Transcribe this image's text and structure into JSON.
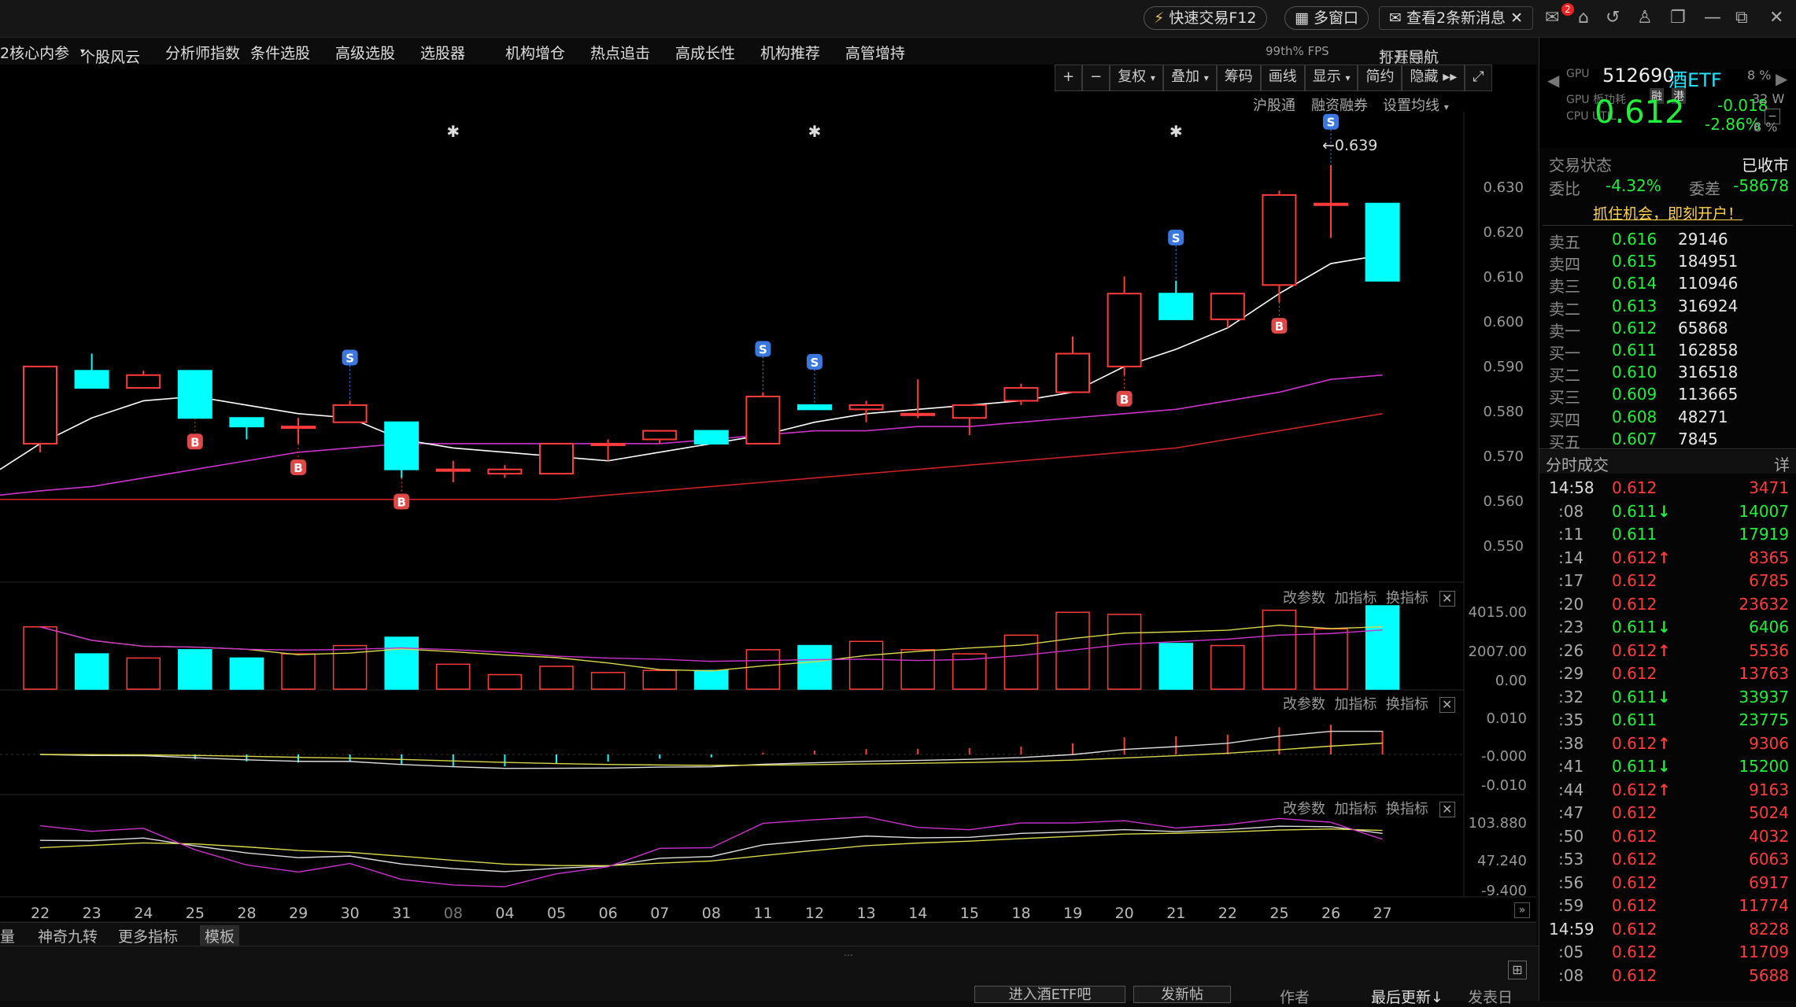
{
  "titlebar": {
    "quick_trade": "快速交易F12",
    "multi_window": "多窗口",
    "messages": "查看2条新消息",
    "mail_badge": "2",
    "fps": "99th% FPS",
    "open_nav": "打开导航",
    "no_return": "不返回"
  },
  "menu": [
    "2核心内参",
    "个股风云",
    "分析师指数",
    "条件选股",
    "高级选股",
    "选股器",
    "机构增仓",
    "热点追击",
    "高成长性",
    "机构推荐",
    "高管增持"
  ],
  "toolbar": [
    "+",
    "−",
    "复权",
    "叠加",
    "筹码",
    "画线",
    "显示",
    "简约",
    "隐藏"
  ],
  "subtoolbar": [
    "沪股通",
    "融资融券",
    "设置均线"
  ],
  "price_axis": [
    "0.630",
    "0.620",
    "0.610",
    "0.600",
    "0.590",
    "0.580",
    "0.570",
    "0.560",
    "0.550"
  ],
  "vol_axis": [
    "4015.00",
    "2007.00",
    "0.00"
  ],
  "macd_axis": [
    "0.010",
    "-0.000",
    "-0.010"
  ],
  "kdj_axis": [
    "103.880",
    "47.240",
    "-9.400"
  ],
  "panel_buttons": {
    "param": "改参数",
    "add": "加指标",
    "swap": "换指标"
  },
  "high_label": "←0.639",
  "dates": [
    "22",
    "23",
    "24",
    "25",
    "28",
    "29",
    "30",
    "31",
    "08",
    "04",
    "05",
    "06",
    "07",
    "08",
    "11",
    "12",
    "13",
    "14",
    "15",
    "18",
    "19",
    "20",
    "21",
    "22",
    "25",
    "26",
    "27"
  ],
  "bottom_tabs": [
    "量",
    "神奇九转",
    "更多指标",
    "模板"
  ],
  "footer": {
    "enter_bar": "进入酒ETF吧",
    "post": "发新帖",
    "author": "作者",
    "last_update": "最后更新↓",
    "post_date": "发表日"
  },
  "quote": {
    "code": "512690",
    "name": "酒ETF",
    "price": "0.612",
    "change": "-0.018",
    "pct": "-2.86%",
    "tag1": "融",
    "tag2": "港",
    "gpu_label": "GPU",
    "gpu_val": "8 %",
    "gpu_power": "GPU 板功耗",
    "power_val": "32 W",
    "cpu_util": "CPU UTIL",
    "cpu_val": "8 %"
  },
  "trade_status": {
    "label": "交易状态",
    "value": "已收市"
  },
  "wei": {
    "ratio_label": "委比",
    "ratio": "-4.32%",
    "diff_label": "委差",
    "diff": "-58678"
  },
  "promo": "抓住机会，即刻开户！",
  "asks": [
    {
      "label": "卖五",
      "price": "0.616",
      "vol": "29146"
    },
    {
      "label": "卖四",
      "price": "0.615",
      "vol": "184951"
    },
    {
      "label": "卖三",
      "price": "0.614",
      "vol": "110946"
    },
    {
      "label": "卖二",
      "price": "0.613",
      "vol": "316924"
    },
    {
      "label": "卖一",
      "price": "0.612",
      "vol": "65868"
    }
  ],
  "bids": [
    {
      "label": "买一",
      "price": "0.611",
      "vol": "162858"
    },
    {
      "label": "买二",
      "price": "0.610",
      "vol": "316518"
    },
    {
      "label": "买三",
      "price": "0.609",
      "vol": "113665"
    },
    {
      "label": "买四",
      "price": "0.608",
      "vol": "48271"
    },
    {
      "label": "买五",
      "price": "0.607",
      "vol": "7845"
    }
  ],
  "ticks_title": "分时成交",
  "ticks_detail": "详",
  "ticks": [
    {
      "t": "14:58",
      "p": "0.612",
      "a": "",
      "v": "3471",
      "c": "red"
    },
    {
      "t": ":08",
      "p": "0.611",
      "a": "↓",
      "v": "14007",
      "c": "green"
    },
    {
      "t": ":11",
      "p": "0.611",
      "a": "",
      "v": "17919",
      "c": "green"
    },
    {
      "t": ":14",
      "p": "0.612",
      "a": "↑",
      "v": "8365",
      "c": "red"
    },
    {
      "t": ":17",
      "p": "0.612",
      "a": "",
      "v": "6785",
      "c": "red"
    },
    {
      "t": ":20",
      "p": "0.612",
      "a": "",
      "v": "23632",
      "c": "red"
    },
    {
      "t": ":23",
      "p": "0.611",
      "a": "↓",
      "v": "6406",
      "c": "green"
    },
    {
      "t": ":26",
      "p": "0.612",
      "a": "↑",
      "v": "5536",
      "c": "red"
    },
    {
      "t": ":29",
      "p": "0.612",
      "a": "",
      "v": "13763",
      "c": "red"
    },
    {
      "t": ":32",
      "p": "0.611",
      "a": "↓",
      "v": "33937",
      "c": "green"
    },
    {
      "t": ":35",
      "p": "0.611",
      "a": "",
      "v": "23775",
      "c": "green"
    },
    {
      "t": ":38",
      "p": "0.612",
      "a": "↑",
      "v": "9306",
      "c": "red"
    },
    {
      "t": ":41",
      "p": "0.611",
      "a": "↓",
      "v": "15200",
      "c": "green"
    },
    {
      "t": ":44",
      "p": "0.612",
      "a": "↑",
      "v": "9163",
      "c": "red"
    },
    {
      "t": ":47",
      "p": "0.612",
      "a": "",
      "v": "5024",
      "c": "red"
    },
    {
      "t": ":50",
      "p": "0.612",
      "a": "",
      "v": "4032",
      "c": "red"
    },
    {
      "t": ":53",
      "p": "0.612",
      "a": "",
      "v": "6063",
      "c": "red"
    },
    {
      "t": ":56",
      "p": "0.612",
      "a": "",
      "v": "6917",
      "c": "red"
    },
    {
      "t": ":59",
      "p": "0.612",
      "a": "",
      "v": "11774",
      "c": "red"
    },
    {
      "t": "14:59",
      "p": "0.612",
      "a": "",
      "v": "8228",
      "c": "red"
    },
    {
      "t": ":05",
      "p": "0.612",
      "a": "",
      "v": "11709",
      "c": "red"
    },
    {
      "t": ":08",
      "p": "0.612",
      "a": "",
      "v": "5688",
      "c": "red"
    }
  ],
  "chart_data": {
    "type": "candlestick",
    "categories": [
      "22",
      "23",
      "24",
      "25",
      "28",
      "29",
      "30",
      "31",
      "08",
      "04",
      "05",
      "06",
      "07",
      "08",
      "11",
      "12",
      "13",
      "14",
      "15",
      "18",
      "19",
      "20",
      "21",
      "22",
      "25",
      "26",
      "27"
    ],
    "ohlc": [
      [
        0.574,
        0.592,
        0.572,
        0.592
      ],
      [
        0.591,
        0.595,
        0.587,
        0.587
      ],
      [
        0.587,
        0.591,
        0.587,
        0.59
      ],
      [
        0.591,
        0.591,
        0.58,
        0.58
      ],
      [
        0.58,
        0.58,
        0.575,
        0.578
      ],
      [
        0.578,
        0.58,
        0.574,
        0.578
      ],
      [
        0.579,
        0.584,
        0.579,
        0.583
      ],
      [
        0.579,
        0.579,
        0.566,
        0.568
      ],
      [
        0.568,
        0.57,
        0.565,
        0.568
      ],
      [
        0.567,
        0.569,
        0.566,
        0.568
      ],
      [
        0.567,
        0.574,
        0.567,
        0.574
      ],
      [
        0.574,
        0.575,
        0.57,
        0.574
      ],
      [
        0.575,
        0.577,
        0.574,
        0.577
      ],
      [
        0.577,
        0.577,
        0.574,
        0.574
      ],
      [
        0.574,
        0.586,
        0.574,
        0.585
      ],
      [
        0.583,
        0.583,
        0.582,
        0.582
      ],
      [
        0.582,
        0.584,
        0.579,
        0.583
      ],
      [
        0.581,
        0.589,
        0.58,
        0.581
      ],
      [
        0.58,
        0.583,
        0.576,
        0.583
      ],
      [
        0.584,
        0.588,
        0.583,
        0.587
      ],
      [
        0.586,
        0.599,
        0.586,
        0.595
      ],
      [
        0.592,
        0.613,
        0.59,
        0.609
      ],
      [
        0.609,
        0.612,
        0.603,
        0.603
      ],
      [
        0.603,
        0.609,
        0.601,
        0.609
      ],
      [
        0.611,
        0.633,
        0.607,
        0.632
      ],
      [
        0.63,
        0.639,
        0.622,
        0.63
      ],
      [
        0.63,
        0.63,
        0.612,
        0.612
      ]
    ],
    "ma5": [
      0.574,
      0.58,
      0.584,
      0.585,
      0.583,
      0.581,
      0.58,
      0.575,
      0.573,
      0.572,
      0.571,
      0.57,
      0.572,
      0.574,
      0.576,
      0.579,
      0.581,
      0.582,
      0.583,
      0.584,
      0.586,
      0.592,
      0.596,
      0.601,
      0.609,
      0.616,
      0.618
    ],
    "ma20": [
      0.563,
      0.564,
      0.566,
      0.568,
      0.57,
      0.572,
      0.573,
      0.574,
      0.574,
      0.574,
      0.574,
      0.574,
      0.574,
      0.575,
      0.576,
      0.577,
      0.577,
      0.578,
      0.578,
      0.579,
      0.58,
      0.581,
      0.582,
      0.584,
      0.586,
      0.589,
      0.59
    ],
    "ma60": [
      0.561,
      0.561,
      0.561,
      0.561,
      0.561,
      0.561,
      0.561,
      0.561,
      0.561,
      0.561,
      0.561,
      0.562,
      0.563,
      0.564,
      0.565,
      0.566,
      0.567,
      0.568,
      0.569,
      0.57,
      0.571,
      0.572,
      0.573,
      0.575,
      0.577,
      0.579,
      0.581
    ],
    "volume": [
      3000,
      1700,
      1500,
      1900,
      1500,
      1700,
      2100,
      2500,
      1200,
      700,
      1100,
      800,
      900,
      900,
      1900,
      2100,
      2300,
      1900,
      1700,
      2600,
      3700,
      3600,
      2200,
      2100,
      3800,
      2900,
      4015
    ],
    "ylim": [
      0.545,
      0.645
    ],
    "signals": {
      "B": [
        3,
        5,
        7,
        21,
        24
      ],
      "S": [
        6,
        14,
        15,
        22,
        25
      ],
      "star": [
        8,
        15,
        22
      ]
    }
  },
  "colors": {
    "up": "#ff3b3b",
    "down": "#00ffff",
    "ma5": "#ffffff",
    "ma20": "#cc33cc",
    "ma60": "#cc2222",
    "yellow": "#d8d84a",
    "bg": "#000000"
  }
}
